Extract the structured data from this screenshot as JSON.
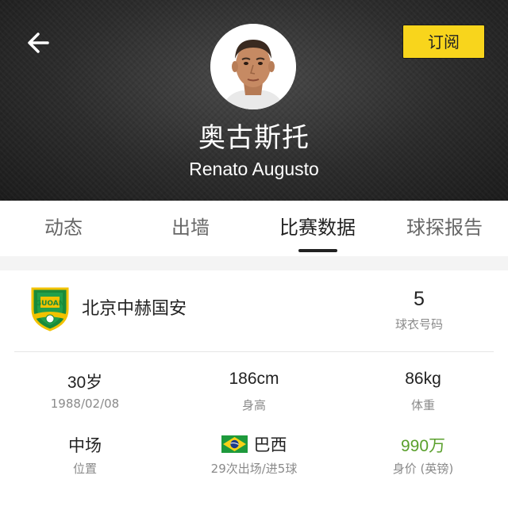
{
  "header": {
    "subscribe_label": "订阅",
    "player_name_cn": "奥古斯托",
    "player_name_en": "Renato Augusto"
  },
  "tabs": [
    {
      "label": "动态"
    },
    {
      "label": "出墙"
    },
    {
      "label": "比赛数据"
    },
    {
      "label": "球探报告"
    }
  ],
  "active_tab": "比赛数据",
  "team": {
    "name": "北京中赫国安",
    "jersey_number": "5",
    "jersey_label": "球衣号码"
  },
  "stats": {
    "age": {
      "value": "30岁",
      "label": "1988/02/08"
    },
    "height": {
      "value": "186cm",
      "label": "身高"
    },
    "weight": {
      "value": "86kg",
      "label": "体重"
    },
    "position": {
      "value": "中场",
      "label": "位置"
    },
    "nationality": {
      "value": "巴西",
      "label": "29次出场/进5球"
    },
    "market_value": {
      "value": "990万",
      "label": "身价 (英镑)"
    }
  },
  "colors": {
    "accent_yellow": "#f8d51c",
    "value_green": "#5aa02c",
    "crest_green": "#1a8a3a"
  },
  "icons": {
    "back": "back-arrow-icon",
    "flag": "brazil-flag-icon",
    "crest": "guoan-crest-icon"
  }
}
